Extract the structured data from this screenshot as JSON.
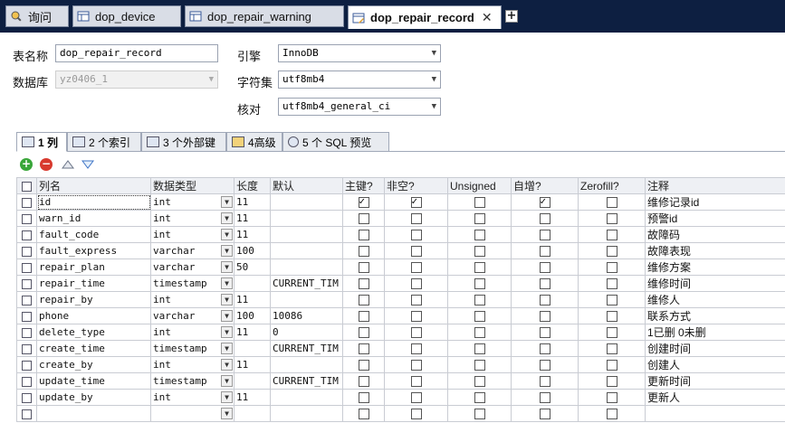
{
  "tabs": [
    {
      "label": "询问",
      "icon": "query-icon"
    },
    {
      "label": "dop_device",
      "icon": "table-icon"
    },
    {
      "label": "dop_repair_warning",
      "icon": "table-icon"
    },
    {
      "label": "dop_repair_record",
      "icon": "table-edit-icon",
      "active": true
    }
  ],
  "form": {
    "table_name_label": "表名称",
    "table_name_value": "dop_repair_record",
    "database_label": "数据库",
    "database_value": "yz0406_1",
    "engine_label": "引擎",
    "engine_value": "InnoDB",
    "charset_label": "字符集",
    "charset_value": "utf8mb4",
    "collation_label": "核对",
    "collation_value": "utf8mb4_general_ci"
  },
  "subtabs": [
    {
      "label": "1 列",
      "active": true
    },
    {
      "label": "2 个索引"
    },
    {
      "label": "3 个外部键"
    },
    {
      "label": "4高级"
    },
    {
      "label": "5 个 SQL 预览"
    }
  ],
  "columns": {
    "name": "列名",
    "type": "数据类型",
    "length": "长度",
    "default": "默认",
    "pk": "主键?",
    "notnull": "非空?",
    "unsigned": "Unsigned",
    "autoinc": "自增?",
    "zerofill": "Zerofill?",
    "comment": "注释"
  },
  "rows": [
    {
      "name": "id",
      "type": "int",
      "length": "11",
      "default": "",
      "pk": true,
      "notnull": true,
      "unsigned": false,
      "autoinc": true,
      "zerofill": false,
      "comment": "维修记录id"
    },
    {
      "name": "warn_id",
      "type": "int",
      "length": "11",
      "default": "",
      "pk": false,
      "notnull": false,
      "unsigned": false,
      "autoinc": false,
      "zerofill": false,
      "comment": "预警id"
    },
    {
      "name": "fault_code",
      "type": "int",
      "length": "11",
      "default": "",
      "pk": false,
      "notnull": false,
      "unsigned": false,
      "autoinc": false,
      "zerofill": false,
      "comment": "故障码"
    },
    {
      "name": "fault_express",
      "type": "varchar",
      "length": "100",
      "default": "",
      "pk": false,
      "notnull": false,
      "unsigned": false,
      "autoinc": false,
      "zerofill": false,
      "comment": "故障表现"
    },
    {
      "name": "repair_plan",
      "type": "varchar",
      "length": "50",
      "default": "",
      "pk": false,
      "notnull": false,
      "unsigned": false,
      "autoinc": false,
      "zerofill": false,
      "comment": "维修方案"
    },
    {
      "name": "repair_time",
      "type": "timestamp",
      "length": "",
      "default": "CURRENT_TIM",
      "pk": false,
      "notnull": false,
      "unsigned": false,
      "autoinc": false,
      "zerofill": false,
      "comment": "维修时间"
    },
    {
      "name": "repair_by",
      "type": "int",
      "length": "11",
      "default": "",
      "pk": false,
      "notnull": false,
      "unsigned": false,
      "autoinc": false,
      "zerofill": false,
      "comment": "维修人"
    },
    {
      "name": "phone",
      "type": "varchar",
      "length": "100",
      "default": "10086",
      "pk": false,
      "notnull": false,
      "unsigned": false,
      "autoinc": false,
      "zerofill": false,
      "comment": "联系方式"
    },
    {
      "name": "delete_type",
      "type": "int",
      "length": "11",
      "default": "0",
      "pk": false,
      "notnull": false,
      "unsigned": false,
      "autoinc": false,
      "zerofill": false,
      "comment": "1已删 0未删"
    },
    {
      "name": "create_time",
      "type": "timestamp",
      "length": "",
      "default": "CURRENT_TIM",
      "pk": false,
      "notnull": false,
      "unsigned": false,
      "autoinc": false,
      "zerofill": false,
      "comment": "创建时间"
    },
    {
      "name": "create_by",
      "type": "int",
      "length": "11",
      "default": "",
      "pk": false,
      "notnull": false,
      "unsigned": false,
      "autoinc": false,
      "zerofill": false,
      "comment": "创建人"
    },
    {
      "name": "update_time",
      "type": "timestamp",
      "length": "",
      "default": "CURRENT_TIM",
      "pk": false,
      "notnull": false,
      "unsigned": false,
      "autoinc": false,
      "zerofill": false,
      "comment": "更新时间"
    },
    {
      "name": "update_by",
      "type": "int",
      "length": "11",
      "default": "",
      "pk": false,
      "notnull": false,
      "unsigned": false,
      "autoinc": false,
      "zerofill": false,
      "comment": "更新人"
    },
    {
      "name": "",
      "type": "",
      "length": "",
      "default": "",
      "pk": false,
      "notnull": false,
      "unsigned": false,
      "autoinc": false,
      "zerofill": false,
      "comment": ""
    }
  ],
  "colors": {
    "titlebar": "#0d1f41",
    "add_button": "#3aa63a",
    "remove_button": "#d83a2e",
    "header_bg": "#eef0f4"
  }
}
